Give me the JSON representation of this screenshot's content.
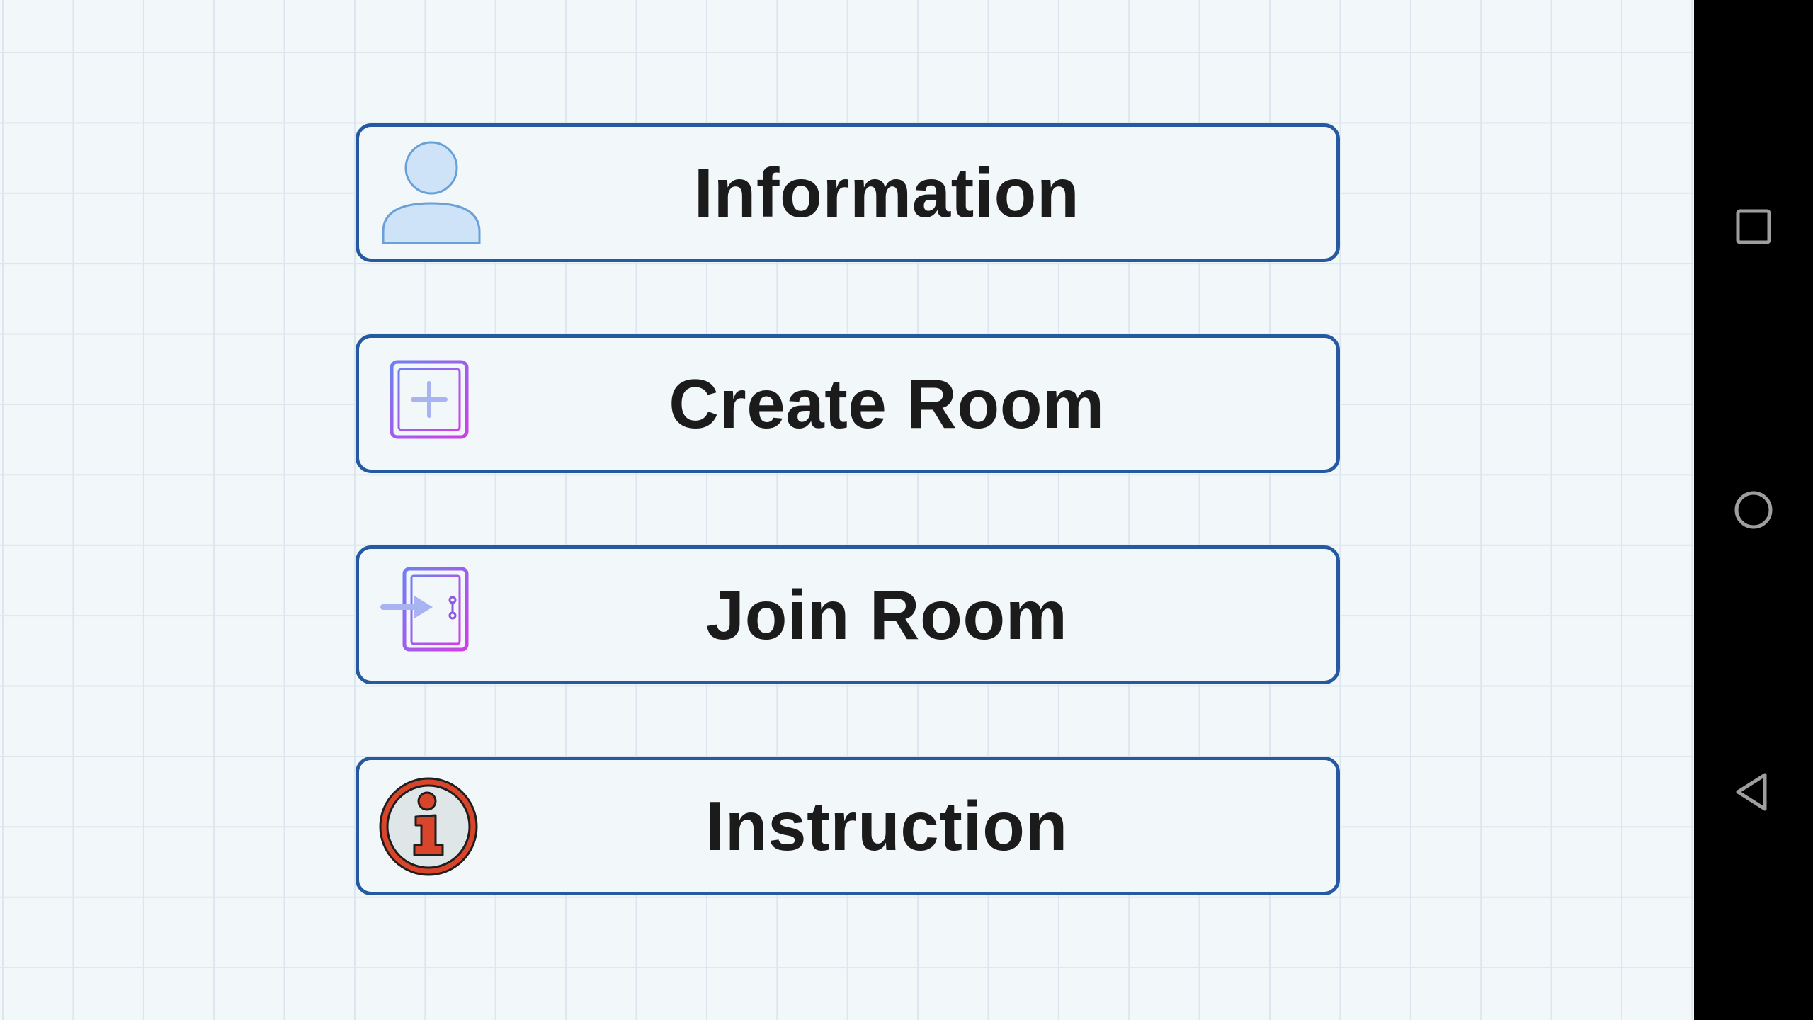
{
  "menu": {
    "items": [
      {
        "id": "information",
        "label": "Information",
        "icon": "person-icon"
      },
      {
        "id": "create_room",
        "label": "Create Room",
        "icon": "add-box-icon"
      },
      {
        "id": "join_room",
        "label": "Join Room",
        "icon": "enter-door-icon"
      },
      {
        "id": "instruction",
        "label": "Instruction",
        "icon": "info-icon"
      }
    ]
  },
  "nav_bar": {
    "buttons": [
      {
        "id": "recents",
        "icon": "square-recents-icon"
      },
      {
        "id": "home",
        "icon": "circle-home-icon"
      },
      {
        "id": "back",
        "icon": "triangle-back-icon"
      }
    ]
  },
  "colors": {
    "background": "#f2f7fa",
    "grid": "#dde6ee",
    "button_border": "#2559a0",
    "label_text": "#1b1b1b",
    "nav_bar": "#000000",
    "nav_icon": "#9e9e9e",
    "info_icon_red": "#d9452b"
  }
}
